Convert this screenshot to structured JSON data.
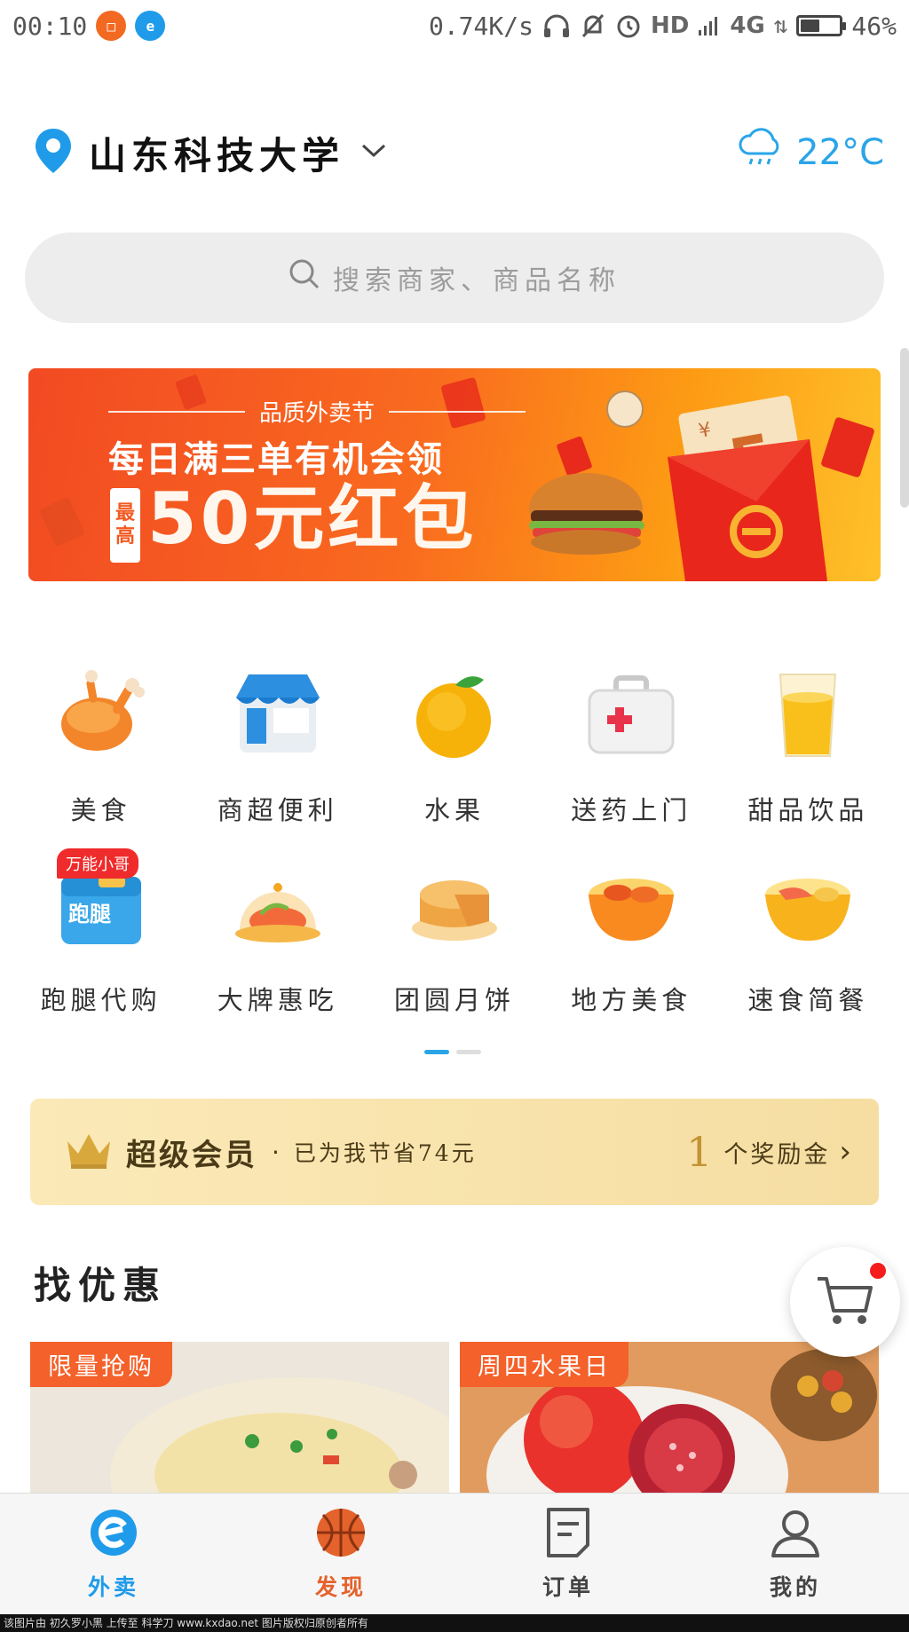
{
  "status_bar": {
    "time": "00:10",
    "speed": "0.74K/s",
    "network": "4G",
    "hd": "HD",
    "battery_text": "46%",
    "battery_level": 0.46
  },
  "header": {
    "location": "山东科技大学",
    "temperature": "22",
    "temp_unit": "°C"
  },
  "search": {
    "placeholder": "搜索商家、商品名称"
  },
  "banner": {
    "subtitle": "品质外卖节",
    "line1": "每日满三单有机会领",
    "tag": [
      "最",
      "高"
    ],
    "headline": "50元红包",
    "coupon_amount": "5",
    "coupon_currency": "¥"
  },
  "categories": [
    {
      "label": "美食",
      "icon": "roast-chicken-icon"
    },
    {
      "label": "商超便利",
      "icon": "store-icon"
    },
    {
      "label": "水果",
      "icon": "orange-icon"
    },
    {
      "label": "送药上门",
      "icon": "medicine-box-icon"
    },
    {
      "label": "甜品饮品",
      "icon": "juice-glass-icon"
    },
    {
      "label": "跑腿代购",
      "icon": "errand-box-icon",
      "badge": "万能小哥",
      "box_text": "跑腿"
    },
    {
      "label": "大牌惠吃",
      "icon": "food-dome-icon"
    },
    {
      "label": "团圆月饼",
      "icon": "mooncake-icon"
    },
    {
      "label": "地方美食",
      "icon": "local-food-bowl-icon"
    },
    {
      "label": "速食简餐",
      "icon": "fast-food-bowl-icon"
    }
  ],
  "membership": {
    "title": "超级会员",
    "dot": "·",
    "saved": "已为我节省74元",
    "reward_count": "1",
    "reward_text": "个奖励金",
    "chevron": "›"
  },
  "deals": {
    "title": "找优惠",
    "cards": [
      {
        "tag": "限量抢购"
      },
      {
        "tag": "周四水果日"
      }
    ]
  },
  "tabbar": {
    "tabs": [
      {
        "label": "外卖",
        "icon": "eleme-logo-icon"
      },
      {
        "label": "发现",
        "icon": "basketball-icon"
      },
      {
        "label": "订单",
        "icon": "order-list-icon"
      },
      {
        "label": "我的",
        "icon": "profile-icon"
      }
    ]
  },
  "footer_text": "该图片由 初久罗小黑 上传至 科学刀 www.kxdao.net 图片版权归原创者所有",
  "colors": {
    "accent_blue": "#2aa5e8",
    "brand_orange": "#f4612a",
    "member_gold": "#c39433"
  }
}
